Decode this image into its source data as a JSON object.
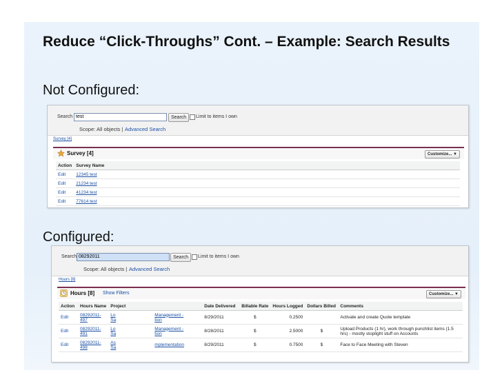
{
  "slide": {
    "title": "Reduce “Click-Throughs” Cont. – Example: Search Results",
    "not_configured_label": "Not Configured:",
    "configured_label": "Configured:"
  },
  "panel1": {
    "search_label": "Search",
    "search_value": "test",
    "search_button": "Search",
    "limit_label": "Limit to items I own",
    "scope_text": "Scope: All objects |",
    "advanced_search": "Advanced Search",
    "results_tab": "Survey [4]",
    "block_title": "Survey [4]",
    "customize_label": "Customize... ▼",
    "columns": [
      "Action",
      "Survey Name"
    ],
    "rows": [
      {
        "action": "Edit",
        "name": "12345 test"
      },
      {
        "action": "Edit",
        "name": "21234 test"
      },
      {
        "action": "Edit",
        "name": "41234 test"
      },
      {
        "action": "Edit",
        "name": "77614 test"
      }
    ]
  },
  "panel2": {
    "search_label": "Search",
    "search_value": "08292011",
    "search_button": "Search",
    "limit_label": "Limit to items I own",
    "scope_text": "Scope: All objects |",
    "advanced_search": "Advanced Search",
    "results_tab": "Hours [8]",
    "block_title": "Hours [8]",
    "show_filters": "Show Filters",
    "customize_label": "Customize... ▼",
    "columns": [
      "Action",
      "Hours Name",
      "Project",
      "",
      "Date Delivered",
      "Billable Rate",
      "Hours Logged",
      "Dollars Billed",
      "Comments"
    ],
    "rows": [
      {
        "action": "Edit",
        "name1": "08292011-",
        "name2": "497",
        "project1": "Lo",
        "project2": "Sa",
        "task1": "Management -",
        "task2": "tion",
        "date": "8/29/2011",
        "rate": "$",
        "hours": "0.2500",
        "billed": "",
        "comment1": "Activate and create Quote template",
        "comment2": ""
      },
      {
        "action": "Edit",
        "name1": "08292011-",
        "name2": "491",
        "project1": "Lo",
        "project2": "Sa",
        "task1": "Management -",
        "task2": "tion",
        "date": "8/28/2011",
        "rate": "$",
        "hours": "2.5000",
        "billed": "$",
        "comment1": "Upload Products (1 hr), work through punchlist items (1.5",
        "comment2": "hrs) - mostly stoplight stuff on Accounts"
      },
      {
        "action": "Edit",
        "name1": "08292011-",
        "name2": "498",
        "project1": "As",
        "project2": "Sa",
        "task1": "mplementation",
        "task2": "",
        "date": "8/29/2011",
        "rate": "$",
        "hours": "0.7500",
        "billed": "$",
        "comment1": "Face to Face Meeting with Steven",
        "comment2": ""
      }
    ]
  },
  "colors": {
    "slide_bg": "#e6f0fa",
    "block_accent": "#7a2e4f",
    "link_blue": "#1a4fa3",
    "search_highlight": "#cfe0f7"
  }
}
